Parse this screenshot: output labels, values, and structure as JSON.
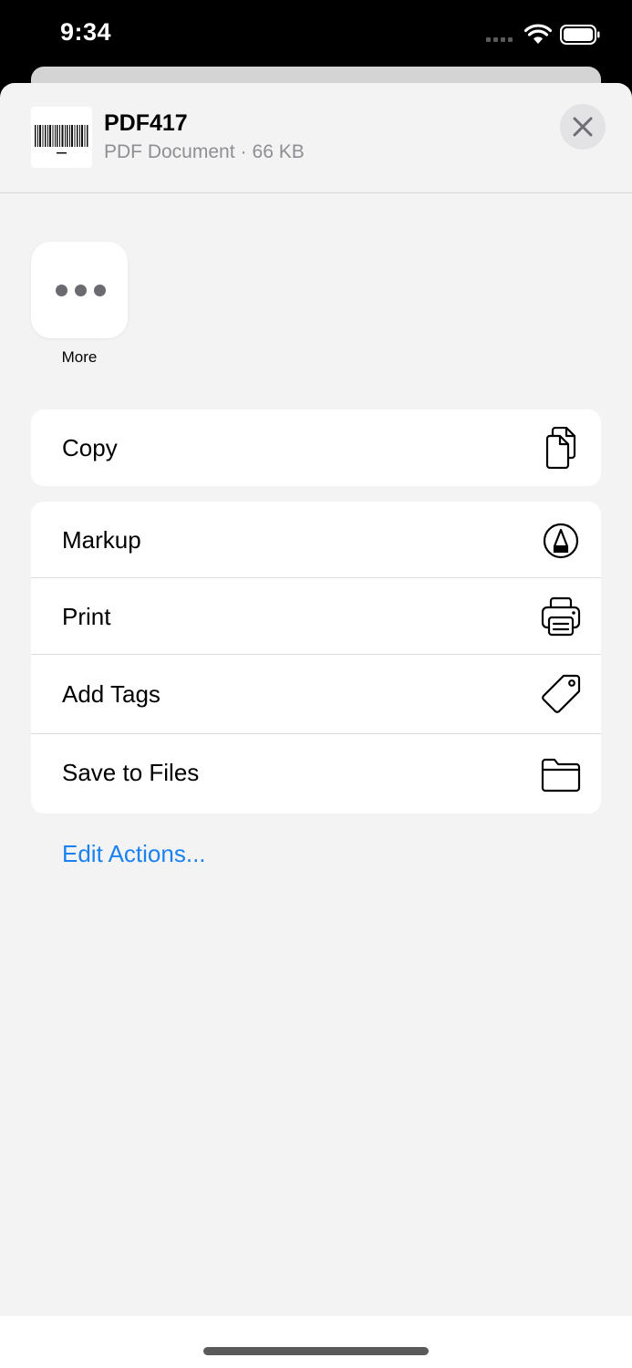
{
  "status": {
    "time": "9:34"
  },
  "file": {
    "title": "PDF417",
    "type": "PDF Document",
    "separator": "·",
    "size": "66 KB"
  },
  "quick": {
    "more_label": "More"
  },
  "copy_group": {
    "label": "Copy",
    "icon": "copy-icon"
  },
  "actions": [
    {
      "label": "Markup",
      "icon": "markup-icon"
    },
    {
      "label": "Print",
      "icon": "print-icon"
    },
    {
      "label": "Add Tags",
      "icon": "tag-icon"
    },
    {
      "label": "Save to Files",
      "icon": "folder-icon"
    }
  ],
  "edit_actions": "Edit Actions...",
  "colors": {
    "accent": "#1a82f0",
    "sheet_bg": "#f3f3f3",
    "secondary_text": "#8e8e93"
  }
}
